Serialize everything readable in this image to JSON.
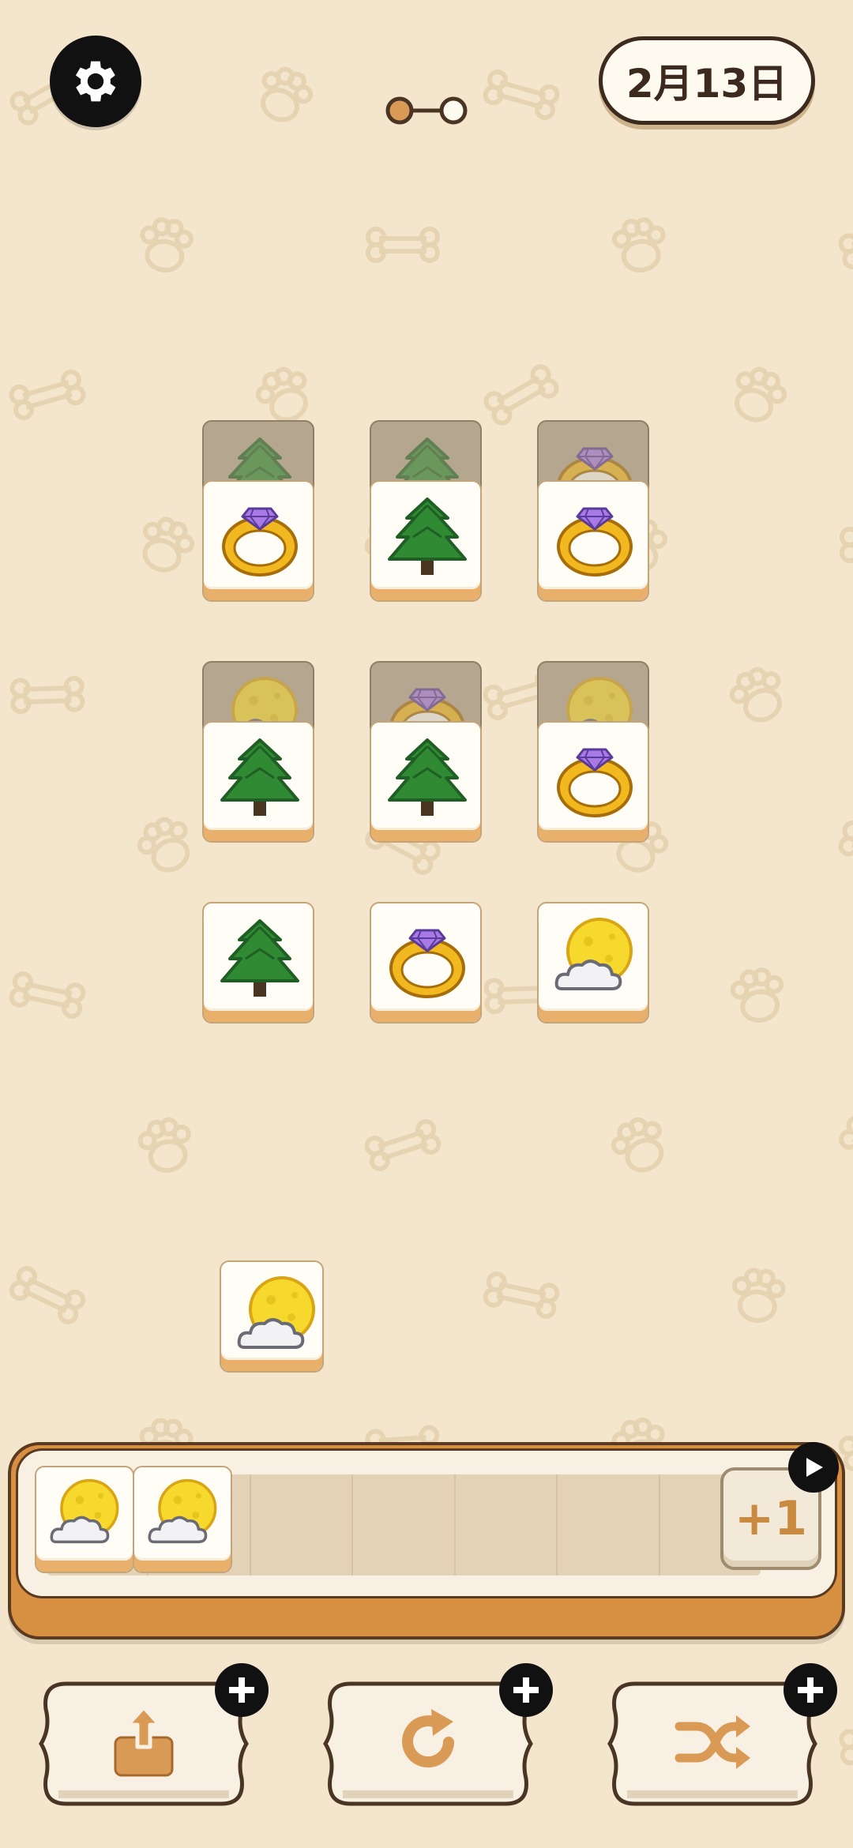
{
  "header": {
    "date": "2月13日",
    "level_progress": {
      "current": 1,
      "total": 2
    }
  },
  "board": {
    "tiles": [
      {
        "icon": "pine-tree",
        "layer": "under"
      },
      {
        "icon": "pine-tree",
        "layer": "under"
      },
      {
        "icon": "gold-ring",
        "layer": "under"
      },
      {
        "icon": "gold-ring",
        "layer": "top"
      },
      {
        "icon": "pine-tree",
        "layer": "top"
      },
      {
        "icon": "gold-ring",
        "layer": "top"
      },
      {
        "icon": "moon-cloud",
        "layer": "under"
      },
      {
        "icon": "gold-ring",
        "layer": "under"
      },
      {
        "icon": "moon-cloud",
        "layer": "under"
      },
      {
        "icon": "pine-tree",
        "layer": "top"
      },
      {
        "icon": "pine-tree",
        "layer": "top"
      },
      {
        "icon": "gold-ring",
        "layer": "top"
      },
      {
        "icon": "pine-tree",
        "layer": "top"
      },
      {
        "icon": "gold-ring",
        "layer": "top"
      },
      {
        "icon": "moon-cloud",
        "layer": "top"
      },
      {
        "icon": "moon-cloud",
        "layer": "top"
      }
    ]
  },
  "tray": {
    "slot_count": 7,
    "tiles": [
      "moon-cloud",
      "moon-cloud"
    ],
    "extra_slot_label": "+1"
  },
  "powerups": [
    {
      "icon": "undo-tile-icon"
    },
    {
      "icon": "refresh-icon"
    },
    {
      "icon": "shuffle-icon"
    }
  ],
  "colors": {
    "background": "#f4e6cc",
    "tile_face": "#fffdf5",
    "tile_edge": "#e8b06a",
    "tray_wood": "#d78f41",
    "accent": "#d99a55"
  }
}
